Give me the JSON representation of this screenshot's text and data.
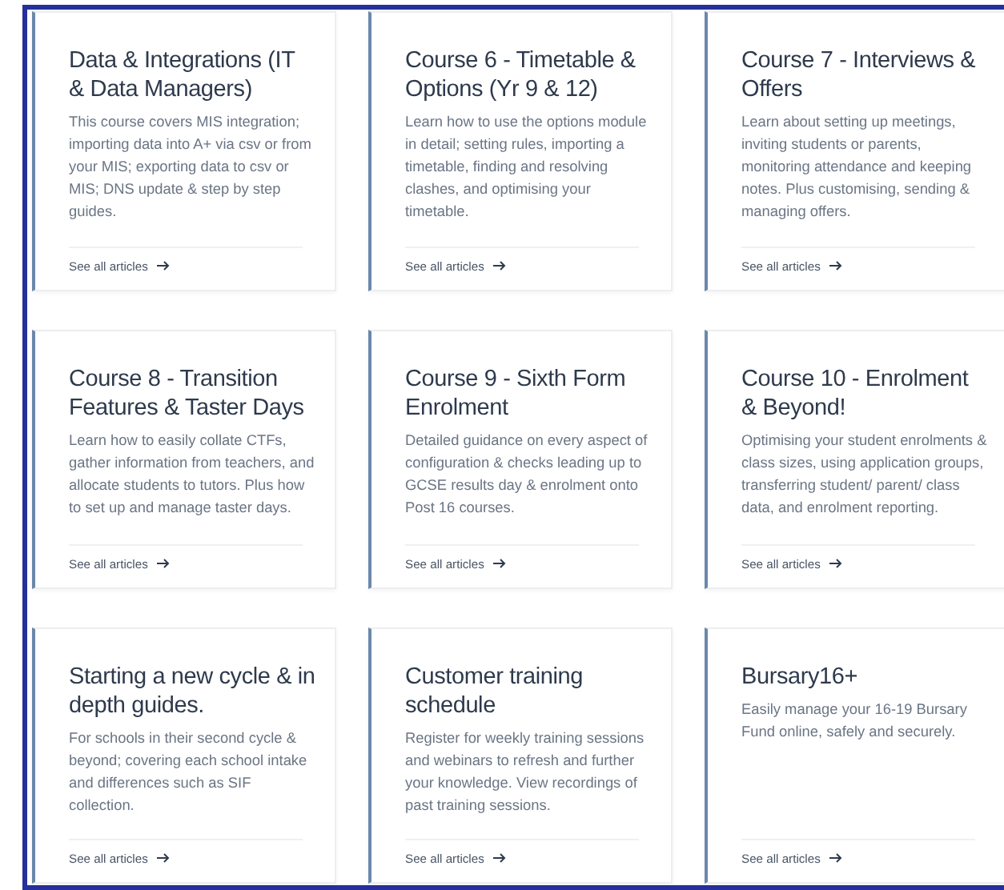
{
  "cards": [
    {
      "title": "Data & Integrations (IT & Data Managers)",
      "description": "This course covers MIS integration; importing data into A+ via csv or from your MIS; exporting data to csv or MIS; DNS update & step by step guides.",
      "link": "See all articles"
    },
    {
      "title": "Course 6 - Timetable & Options (Yr 9 & 12)",
      "description": "Learn how to use the options module in detail; setting rules, importing a timetable, finding and resolving clashes, and optimising your timetable.",
      "link": "See all articles"
    },
    {
      "title": "Course 7 - Interviews & Offers",
      "description": "Learn about setting up meetings, inviting students or parents, monitoring attendance and keeping notes. Plus customising, sending & managing offers.",
      "link": "See all articles"
    },
    {
      "title": "Course 8 - Transition Features & Taster Days",
      "description": "Learn how to easily collate CTFs, gather information from teachers, and allocate students to tutors. Plus how to set up and manage taster days.",
      "link": "See all articles"
    },
    {
      "title": "Course 9 - Sixth Form Enrolment",
      "description": "Detailed guidance on every aspect of configuration & checks leading up to GCSE results day & enrolment onto Post 16 courses.",
      "link": "See all articles"
    },
    {
      "title": "Course 10 - Enrolment & Beyond!",
      "description": "Optimising your student enrolments & class sizes, using application groups, transferring student/ parent/ class data, and enrolment reporting.",
      "link": "See all articles"
    },
    {
      "title": "Starting a new cycle & in depth guides.",
      "description": "For schools in their second cycle & beyond; covering each school intake and differences such as SIF collection.",
      "link": "See all articles"
    },
    {
      "title": "Customer training schedule",
      "description": "Register for weekly training sessions and webinars to refresh and further your knowledge. View recordings of past training sessions.",
      "link": "See all articles"
    },
    {
      "title": "Bursary16+",
      "description": "Easily manage your 16-19 Bursary Fund online, safely and securely.",
      "link": "See all articles"
    }
  ]
}
